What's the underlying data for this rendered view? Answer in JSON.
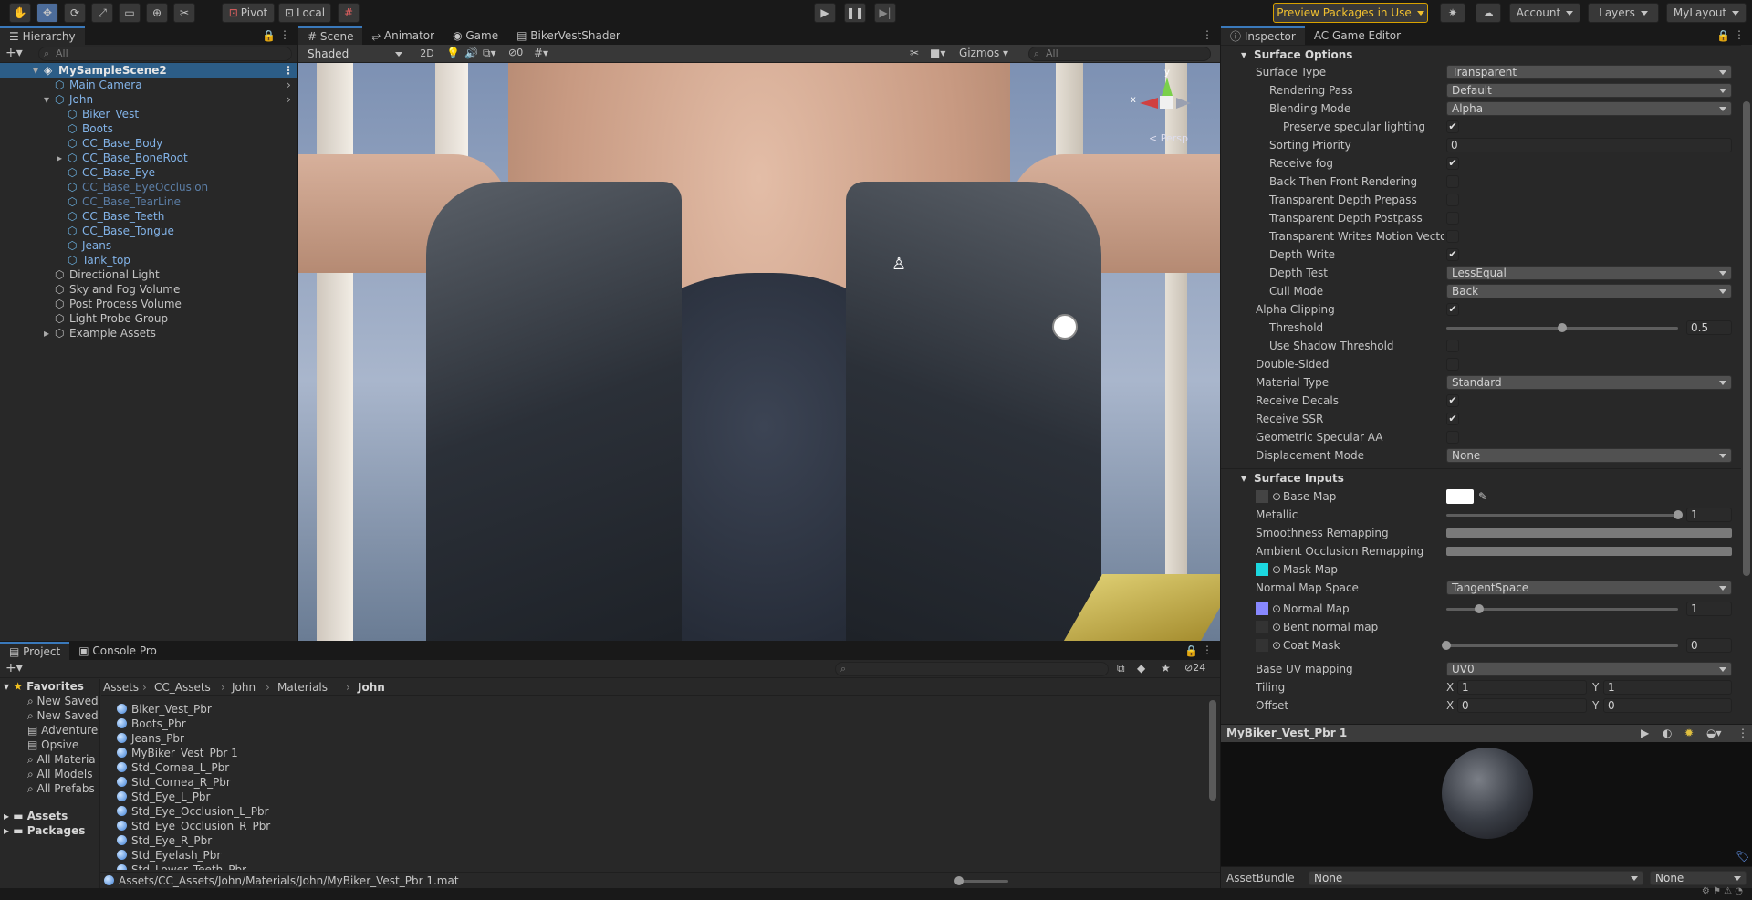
{
  "toolbar": {
    "tools": [
      "hand-tool",
      "move-tool",
      "rotate-tool",
      "scale-tool",
      "rect-tool",
      "transform-tool",
      "custom-tool"
    ],
    "pivot_label": "Pivot",
    "local_label": "Local",
    "preview_packages": "Preview Packages in Use",
    "account": "Account",
    "layers": "Layers",
    "layout": "MyLayout"
  },
  "hierarchy": {
    "tab": "Hierarchy",
    "search_placeholder": "All",
    "scene": "MySampleScene2",
    "rows": [
      {
        "label": "Main Camera",
        "indent": 1,
        "style": "blue"
      },
      {
        "label": "John",
        "indent": 1,
        "style": "blue"
      },
      {
        "label": "Biker_Vest",
        "indent": 2,
        "style": "blue"
      },
      {
        "label": "Boots",
        "indent": 2,
        "style": "blue"
      },
      {
        "label": "CC_Base_Body",
        "indent": 2,
        "style": "blue"
      },
      {
        "label": "CC_Base_BoneRoot",
        "indent": 2,
        "style": "blue"
      },
      {
        "label": "CC_Base_Eye",
        "indent": 2,
        "style": "blue"
      },
      {
        "label": "CC_Base_EyeOcclusion",
        "indent": 2,
        "style": "dim"
      },
      {
        "label": "CC_Base_TearLine",
        "indent": 2,
        "style": "dim"
      },
      {
        "label": "CC_Base_Teeth",
        "indent": 2,
        "style": "blue"
      },
      {
        "label": "CC_Base_Tongue",
        "indent": 2,
        "style": "blue"
      },
      {
        "label": "Jeans",
        "indent": 2,
        "style": "blue"
      },
      {
        "label": "Tank_top",
        "indent": 2,
        "style": "blue"
      },
      {
        "label": "Directional Light",
        "indent": 1,
        "style": "plain"
      },
      {
        "label": "Sky and Fog Volume",
        "indent": 1,
        "style": "plain"
      },
      {
        "label": "Post Process Volume",
        "indent": 1,
        "style": "plain"
      },
      {
        "label": "Light Probe Group",
        "indent": 1,
        "style": "plain"
      },
      {
        "label": "Example Assets",
        "indent": 1,
        "style": "plain"
      }
    ]
  },
  "scene": {
    "tabs": [
      "Scene",
      "Animator",
      "Game",
      "BikerVestShader"
    ],
    "shading": "Shaded",
    "mode2d": "2D",
    "hidden_count": "0",
    "gizmos": "Gizmos",
    "search_placeholder": "All",
    "gizmo_axes": {
      "x": "x",
      "y": "y"
    },
    "persp": "< Persp"
  },
  "inspector": {
    "tabs": [
      "Inspector",
      "AC Game Editor"
    ],
    "surface_options": "Surface Options",
    "surface_type_label": "Surface Type",
    "surface_type": "Transparent",
    "rendering_pass_label": "Rendering Pass",
    "rendering_pass": "Default",
    "blending_mode_label": "Blending Mode",
    "blending_mode": "Alpha",
    "preserve_spec_label": "Preserve specular lighting",
    "sorting_priority_label": "Sorting Priority",
    "sorting_priority": "0",
    "receive_fog_label": "Receive fog",
    "back_then_front_label": "Back Then Front Rendering",
    "depth_prepass_label": "Transparent Depth Prepass",
    "depth_postpass_label": "Transparent Depth Postpass",
    "writes_motion_label": "Transparent Writes Motion Vectors",
    "depth_write_label": "Depth Write",
    "depth_test_label": "Depth Test",
    "depth_test": "LessEqual",
    "cull_mode_label": "Cull Mode",
    "cull_mode": "Back",
    "alpha_clipping_label": "Alpha Clipping",
    "threshold_label": "Threshold",
    "threshold": "0.5",
    "threshold_fraction": 0.5,
    "use_shadow_threshold_label": "Use Shadow Threshold",
    "double_sided_label": "Double-Sided",
    "material_type_label": "Material Type",
    "material_type": "Standard",
    "receive_decals_label": "Receive Decals",
    "receive_ssr_label": "Receive SSR",
    "geometric_aa_label": "Geometric Specular AA",
    "displacement_label": "Displacement Mode",
    "displacement": "None",
    "surface_inputs": "Surface Inputs",
    "base_map_label": "Base Map",
    "metallic_label": "Metallic",
    "metallic": "1",
    "metallic_fraction": 1.0,
    "smoothness_label": "Smoothness Remapping",
    "ao_label": "Ambient Occlusion Remapping",
    "mask_map_label": "Mask Map",
    "normal_space_label": "Normal Map Space",
    "normal_space": "TangentSpace",
    "normal_map_label": "Normal Map",
    "normal_map": "1",
    "normal_map_fraction": 0.14,
    "bent_normal_label": "Bent normal map",
    "coat_mask_label": "Coat Mask",
    "coat_mask": "0",
    "coat_mask_fraction": 0.0,
    "base_uv_label": "Base UV mapping",
    "base_uv": "UV0",
    "tiling_label": "Tiling",
    "tiling_x": "1",
    "tiling_y": "1",
    "offset_label": "Offset",
    "offset_x": "0",
    "offset_y": "0",
    "x_label": "X",
    "y_label": "Y",
    "preview_title": "MyBiker_Vest_Pbr 1",
    "assetbundle_label": "AssetBundle",
    "assetbundle": "None",
    "assetbundle_variant": "None"
  },
  "project": {
    "tabs": [
      "Project",
      "Console Pro"
    ],
    "favorites_label": "Favorites",
    "favorites": [
      "New Saved",
      "New Saved",
      "AdventureC",
      "Opsive",
      "All Materia",
      "All Models",
      "All Prefabs"
    ],
    "roots": [
      "Assets",
      "Packages"
    ],
    "breadcrumb": [
      "Assets",
      "CC_Assets",
      "John",
      "Materials",
      "John"
    ],
    "files": [
      "Biker_Vest_Pbr",
      "Boots_Pbr",
      "Jeans_Pbr",
      "MyBiker_Vest_Pbr 1",
      "Std_Cornea_L_Pbr",
      "Std_Cornea_R_Pbr",
      "Std_Eye_L_Pbr",
      "Std_Eye_Occlusion_L_Pbr",
      "Std_Eye_Occlusion_R_Pbr",
      "Std_Eye_R_Pbr",
      "Std_Eyelash_Pbr",
      "Std_Lower_Teeth_Pbr"
    ],
    "hidden_count": "24",
    "path": "Assets/CC_Assets/John/Materials/John/MyBiker_Vest_Pbr 1.mat"
  }
}
